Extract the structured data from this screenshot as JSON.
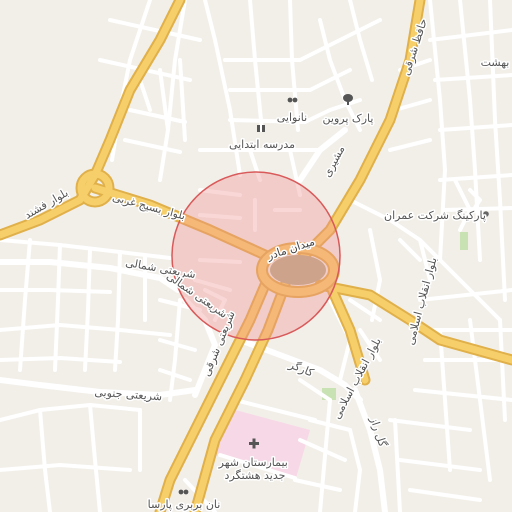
{
  "map": {
    "highlight": {
      "fill": "#f08c8c",
      "stroke": "#d95a5a"
    },
    "colors": {
      "background": "#f2efe9",
      "road_minor": "#ffffff",
      "road_major": "#f7cf6a",
      "road_major_casing": "#e0b04a",
      "hospital_area": "#f7d8e6",
      "park": "#c9e2b3",
      "square_center": "#bcb08a"
    },
    "streets": {
      "hafez_sharghi": "حافظ شرقی",
      "bolvar_fashand": "بلوار فشند",
      "bolvar_basij_gharbi": "بلوار بسیج غربی",
      "meydan_madar": "میدان مادر",
      "shariati_shomali": "شریعتی شمالی",
      "shariati_sharghi": "شریعتی شرقی",
      "shariati_jonubi": "شریعتی جنوبی",
      "bolvar_enghelab_1": "بلوار انقلاب اسلامی",
      "bolvar_enghelab_2": "بلوار انقلاب اسلامی",
      "mashiri": "مشیری",
      "kargar": "کارگر",
      "gol_raz": "گل راز",
      "behesht": "بهشت"
    },
    "pois": [
      {
        "name": "نانوایی",
        "icon": "bakery-icon"
      },
      {
        "name": "پارک پروین",
        "icon": "tree-icon"
      },
      {
        "name": "مدرسه ابتدایی",
        "icon": "school-icon"
      },
      {
        "name": "پارکینگ شرکت عمران",
        "icon": "parking-icon"
      },
      {
        "name": "بیمارستان شهر جدید هشتگرد",
        "icon": "hospital-cross-icon"
      },
      {
        "name": "نان بربری پارسا",
        "icon": "bakery-icon"
      }
    ]
  }
}
